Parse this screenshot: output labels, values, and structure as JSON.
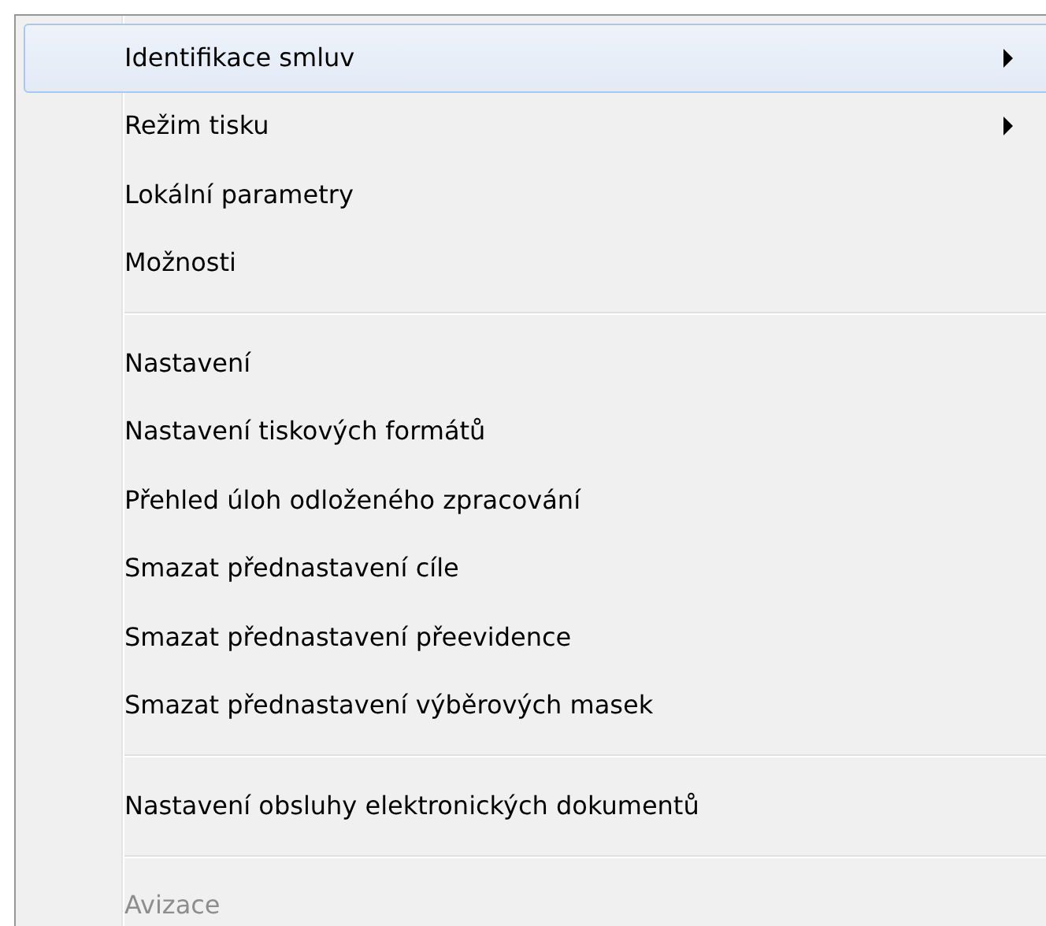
{
  "menu": {
    "items": [
      {
        "kind": "item",
        "label": "Identifikace smluv",
        "submenu": true,
        "selected": true,
        "disabled": false
      },
      {
        "kind": "item",
        "label": "Režim tisku",
        "submenu": true,
        "selected": false,
        "disabled": false
      },
      {
        "kind": "item",
        "label": "Lokální parametry",
        "submenu": false,
        "selected": false,
        "disabled": false
      },
      {
        "kind": "item",
        "label": "Možnosti",
        "submenu": false,
        "selected": false,
        "disabled": false
      },
      {
        "kind": "separator"
      },
      {
        "kind": "item",
        "label": "Nastavení",
        "submenu": false,
        "selected": false,
        "disabled": false
      },
      {
        "kind": "item",
        "label": "Nastavení tiskových formátů",
        "submenu": false,
        "selected": false,
        "disabled": false
      },
      {
        "kind": "item",
        "label": "Přehled úloh odloženého zpracování",
        "submenu": false,
        "selected": false,
        "disabled": false
      },
      {
        "kind": "item",
        "label": "Smazat přednastavení cíle",
        "submenu": false,
        "selected": false,
        "disabled": false
      },
      {
        "kind": "item",
        "label": "Smazat přednastavení přeevidence",
        "submenu": false,
        "selected": false,
        "disabled": false
      },
      {
        "kind": "item",
        "label": "Smazat přednastavení výběrových masek",
        "submenu": false,
        "selected": false,
        "disabled": false
      },
      {
        "kind": "separator"
      },
      {
        "kind": "item",
        "label": "Nastavení obsluhy elektronických dokumentů",
        "submenu": false,
        "selected": false,
        "disabled": false
      },
      {
        "kind": "separator"
      },
      {
        "kind": "item",
        "label": "Avizace",
        "submenu": false,
        "selected": false,
        "disabled": true
      }
    ]
  }
}
